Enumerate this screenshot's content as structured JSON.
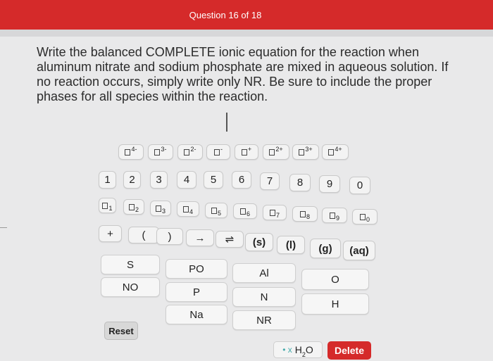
{
  "header": {
    "question_counter": "Question 16 of 18"
  },
  "question": {
    "text": "Write the balanced COMPLETE ionic equation for the reaction when aluminum nitrate and sodium phosphate are mixed in aqueous solution. If no reaction occurs, simply write only NR. Be sure to include the proper phases for all species within the reaction."
  },
  "keypad": {
    "charges": [
      "4-",
      "3-",
      "2-",
      "-",
      "+",
      "2+",
      "3+",
      "4+"
    ],
    "coefficients": [
      "1",
      "2",
      "3",
      "4",
      "5",
      "6",
      "7",
      "8",
      "9",
      "0"
    ],
    "subscripts": [
      "1",
      "2",
      "3",
      "4",
      "5",
      "6",
      "7",
      "8",
      "9",
      "0"
    ],
    "symbols": {
      "plus": "+",
      "open_paren": "(",
      "close_paren": ")",
      "arrow": "→",
      "equilibrium": "⇌",
      "phase_s": "(s)",
      "phase_l": "(l)",
      "phase_g": "(g)",
      "phase_aq": "(aq)"
    },
    "elements": {
      "s": "S",
      "po": "PO",
      "al": "Al",
      "o": "O",
      "no": "NO",
      "p": "P",
      "n": "N",
      "h": "H",
      "na": "Na",
      "nr": "NR"
    },
    "reset": "Reset",
    "water": {
      "prefix": "• x",
      "formula": "H",
      "sub": "2",
      "suffix": "O"
    },
    "delete": "Delete"
  },
  "colors": {
    "accent": "#d52a2a",
    "background": "#e9e9ea",
    "key": "#f3f3f3"
  }
}
